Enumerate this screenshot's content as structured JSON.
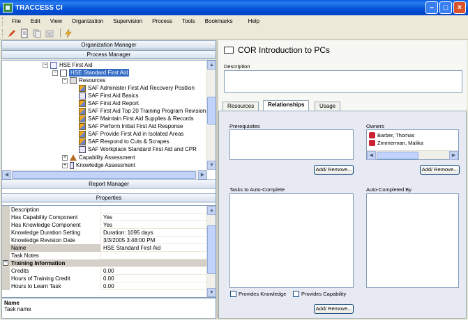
{
  "window": {
    "title": "TRACCESS CI"
  },
  "menu": [
    "File",
    "Edit",
    "View",
    "Organization",
    "Supervision",
    "Process",
    "Tools",
    "Bookmarks",
    "Help"
  ],
  "toolbar_icons": [
    "pencil-icon",
    "document-icon",
    "copy-icon",
    "delete-icon",
    "lightning-icon"
  ],
  "left": {
    "org_manager": "Organization Manager",
    "process_manager": "Process Manager",
    "report_manager": "Report Manager",
    "properties": "Properties",
    "tree": [
      {
        "label": "HSE  First Aid",
        "expander": "−"
      },
      {
        "label": "HSE  Standard First Aid",
        "expander": "−",
        "selected": true
      },
      {
        "label": "Resources",
        "expander": "−"
      },
      {
        "label": "SAF  Administer First Aid Recovery Position"
      },
      {
        "label": "SAF  First Aid Basics"
      },
      {
        "label": "SAF  First Aid Report"
      },
      {
        "label": "SAF  First Aid Top 20 Training Program Revisions"
      },
      {
        "label": "SAF  Maintain First Aid Supplies & Records"
      },
      {
        "label": "SAF  Perform Initial First Aid Response"
      },
      {
        "label": "SAF  Provide First Aid in Isolated Areas"
      },
      {
        "label": "SAF  Respond to Cuts & Scrapes"
      },
      {
        "label": "SAF  Workplace Standard First Aid and CPR"
      },
      {
        "label": "Capability Assessment",
        "expander": "+"
      },
      {
        "label": "Knowledge Assessment",
        "expander": "+"
      }
    ],
    "properties_rows": [
      {
        "k": "Description",
        "v": ""
      },
      {
        "k": "Has Capability Component",
        "v": "Yes"
      },
      {
        "k": "Has Knowledge Component",
        "v": "Yes"
      },
      {
        "k": "Knowledge Duration Setting",
        "v": "Duration: 1095 days"
      },
      {
        "k": "Knowledge Revision Date",
        "v": "3/3/2005 3:48:00 PM"
      },
      {
        "k": "Name",
        "v": "HSE  Standard First Aid",
        "selected": true
      },
      {
        "k": "Task Notes",
        "v": ""
      },
      {
        "section": "Training Information"
      },
      {
        "k": "Credits",
        "v": "0.00"
      },
      {
        "k": "Hours of Training Credit",
        "v": "0.00"
      },
      {
        "k": "Hours to Learn Task",
        "v": "0.00"
      }
    ],
    "desc_title": "Name",
    "desc_text": "Task name"
  },
  "right": {
    "title": "COR  Introduction to PCs",
    "description_label": "Description",
    "tabs": [
      "Resources",
      "Relationships",
      "Usage"
    ],
    "active_tab": "Relationships",
    "prerequisites_label": "Prerequisites",
    "owners_label": "Owners",
    "owners": [
      "Barber, Thomas",
      "Zimmerman, Malika"
    ],
    "add_remove": "Add/ Remove...",
    "tasks_label": "Tasks to Auto-Complete",
    "autocompleted_label": "Auto-Completed By",
    "provides_knowledge": "Provides Knowledge",
    "provides_capability": "Provides Capability"
  },
  "colors": {
    "titlebar": "#0a5ee0",
    "selection": "#316ac5",
    "panel": "#e7eaf3"
  }
}
